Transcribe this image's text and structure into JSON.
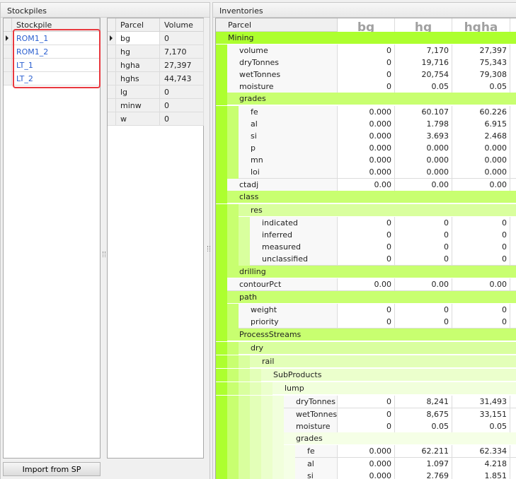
{
  "stockpiles": {
    "title": "Stockpiles",
    "column": "Stockpile",
    "items": [
      "ROM1_1",
      "ROM1_2",
      "LT_1",
      "LT_2"
    ],
    "import_button": "Import from SP"
  },
  "parcels": {
    "columns": [
      "Parcel",
      "Volume"
    ],
    "rows": [
      [
        "bg",
        "0"
      ],
      [
        "hg",
        "7,170"
      ],
      [
        "hgha",
        "27,397"
      ],
      [
        "hghs",
        "44,743"
      ],
      [
        "lg",
        "0"
      ],
      [
        "minw",
        "0"
      ],
      [
        "w",
        "0"
      ]
    ]
  },
  "colors": {
    "highlight": "#e8393f",
    "group0": "#adff2f"
  },
  "inventories": {
    "title": "Inventories",
    "parcel_header": "Parcel",
    "columns": [
      "bg",
      "hg",
      "hgha"
    ],
    "rows": [
      {
        "d": 0,
        "g": true,
        "label": "Mining"
      },
      {
        "d": 1,
        "label": "volume",
        "v": [
          "0",
          "7,170",
          "27,397"
        ]
      },
      {
        "d": 1,
        "label": "dryTonnes",
        "v": [
          "0",
          "19,716",
          "75,343"
        ]
      },
      {
        "d": 1,
        "label": "wetTonnes",
        "v": [
          "0",
          "20,754",
          "79,308"
        ]
      },
      {
        "d": 1,
        "label": "moisture",
        "v": [
          "0",
          "0.05",
          "0.05"
        ]
      },
      {
        "d": 1,
        "g": true,
        "label": "grades"
      },
      {
        "d": 2,
        "label": "fe",
        "v": [
          "0.000",
          "60.107",
          "60.226"
        ]
      },
      {
        "d": 2,
        "label": "al",
        "v": [
          "0.000",
          "1.798",
          "6.915"
        ]
      },
      {
        "d": 2,
        "label": "si",
        "v": [
          "0.000",
          "3.693",
          "2.468"
        ]
      },
      {
        "d": 2,
        "label": "p",
        "v": [
          "0.000",
          "0.000",
          "0.000"
        ]
      },
      {
        "d": 2,
        "label": "mn",
        "v": [
          "0.000",
          "0.000",
          "0.000"
        ]
      },
      {
        "d": 2,
        "label": "loi",
        "v": [
          "0.000",
          "0.000",
          "0.000"
        ]
      },
      {
        "d": 1,
        "label": "ctadj",
        "v": [
          "0.00",
          "0.00",
          "0.00"
        ]
      },
      {
        "d": 1,
        "g": true,
        "label": "class"
      },
      {
        "d": 2,
        "g": true,
        "label": "res"
      },
      {
        "d": 3,
        "label": "indicated",
        "v": [
          "0",
          "0",
          "0"
        ]
      },
      {
        "d": 3,
        "label": "inferred",
        "v": [
          "0",
          "0",
          "0"
        ]
      },
      {
        "d": 3,
        "label": "measured",
        "v": [
          "0",
          "0",
          "0"
        ]
      },
      {
        "d": 3,
        "label": "unclassified",
        "v": [
          "0",
          "0",
          "0"
        ]
      },
      {
        "d": 1,
        "g": true,
        "label": "drilling"
      },
      {
        "d": 1,
        "label": "contourPct",
        "v": [
          "0.00",
          "0.00",
          "0.00"
        ]
      },
      {
        "d": 1,
        "g": true,
        "label": "path"
      },
      {
        "d": 2,
        "label": "weight",
        "v": [
          "0",
          "0",
          "0"
        ]
      },
      {
        "d": 2,
        "label": "priority",
        "v": [
          "0",
          "0",
          "0"
        ]
      },
      {
        "d": 1,
        "g": true,
        "label": "ProcessStreams"
      },
      {
        "d": 2,
        "g": true,
        "label": "dry"
      },
      {
        "d": 3,
        "g": true,
        "label": "rail"
      },
      {
        "d": 4,
        "g": true,
        "label": "SubProducts"
      },
      {
        "d": 5,
        "g": true,
        "label": "lump"
      },
      {
        "d": 6,
        "label": "dryTonnes",
        "v": [
          "0",
          "8,241",
          "31,493"
        ]
      },
      {
        "d": 6,
        "label": "wetTonnes",
        "v": [
          "0",
          "8,675",
          "33,151"
        ]
      },
      {
        "d": 6,
        "label": "moisture",
        "v": [
          "0",
          "0.05",
          "0.05"
        ]
      },
      {
        "d": 6,
        "g": true,
        "label": "grades"
      },
      {
        "d": 7,
        "label": "fe",
        "v": [
          "0.000",
          "62.211",
          "62.334"
        ]
      },
      {
        "d": 7,
        "label": "al",
        "v": [
          "0.000",
          "1.097",
          "4.218"
        ]
      },
      {
        "d": 7,
        "label": "si",
        "v": [
          "0.000",
          "2.769",
          "1.851"
        ]
      }
    ]
  }
}
